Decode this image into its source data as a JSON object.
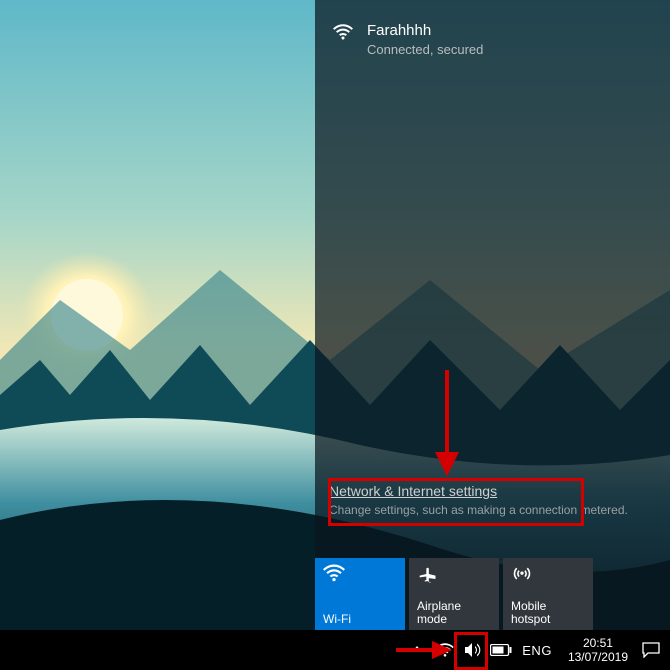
{
  "network": {
    "ssid": "Farahhhh",
    "status": "Connected, secured"
  },
  "settings": {
    "link": "Network & Internet settings",
    "desc": "Change settings, such as making a connection metered."
  },
  "tiles": {
    "wifi": "Wi-Fi",
    "airplane": "Airplane mode",
    "hotspot": "Mobile hotspot"
  },
  "tray": {
    "lang": "ENG",
    "time": "20:51",
    "date": "13/07/2019"
  }
}
